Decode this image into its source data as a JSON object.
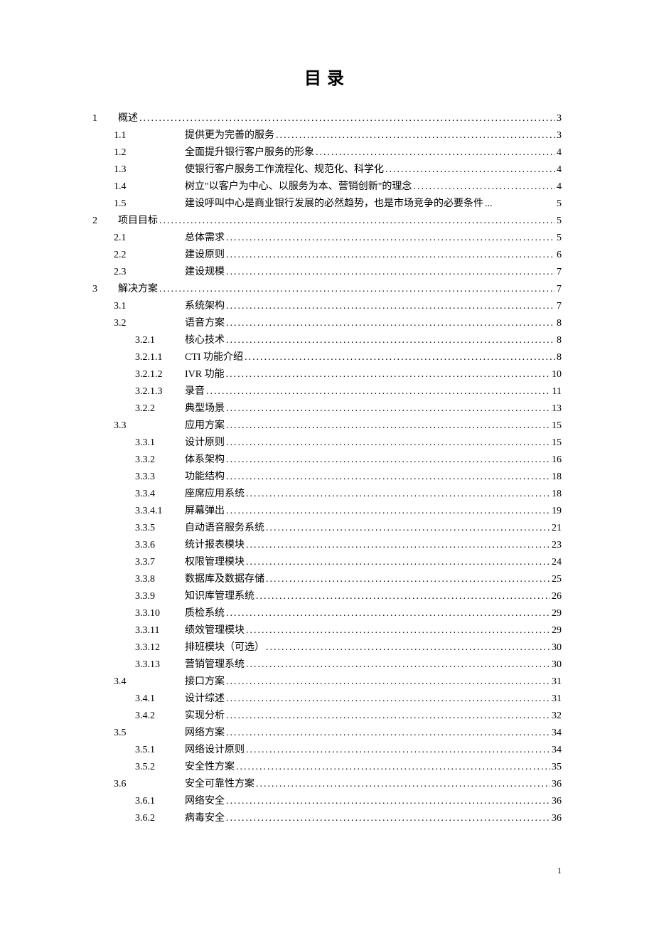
{
  "title": "目录",
  "page_number": "1",
  "toc": [
    {
      "level": 0,
      "num": "1",
      "text": "概述",
      "page": "3",
      "inlineSection": true
    },
    {
      "level": 1,
      "num": "1.1",
      "text": "提供更为完善的服务",
      "page": "3"
    },
    {
      "level": 1,
      "num": "1.2",
      "text": "全面提升银行客户服务的形象",
      "page": "4"
    },
    {
      "level": 1,
      "num": "1.3",
      "text": "使银行客户服务工作流程化、规范化、科学化",
      "page": "4"
    },
    {
      "level": 1,
      "num": "1.4",
      "text": "树立\"以客户为中心、以服务为本、营销创新\"的理念",
      "page": "4"
    },
    {
      "level": 1,
      "num": "1.5",
      "text": "建设呼叫中心是商业银行发展的必然趋势，也是市场竞争的必要条件",
      "page": "5",
      "tight": true
    },
    {
      "level": 0,
      "num": "2",
      "text": "项目目标",
      "page": "5",
      "inlineSection": true
    },
    {
      "level": 1,
      "num": "2.1",
      "text": "总体需求",
      "page": "5"
    },
    {
      "level": 1,
      "num": "2.2",
      "text": "建设原则",
      "page": "6"
    },
    {
      "level": 1,
      "num": "2.3",
      "text": "建设规模",
      "page": "7"
    },
    {
      "level": 0,
      "num": "3",
      "text": "解决方案",
      "page": "7",
      "inlineSection": true
    },
    {
      "level": 1,
      "num": "3.1",
      "text": "系统架构",
      "page": "7"
    },
    {
      "level": 1,
      "num": "3.2",
      "text": "语音方案",
      "page": "8"
    },
    {
      "level": 2,
      "num": "3.2.1",
      "text": "核心技术",
      "page": "8"
    },
    {
      "level": 3,
      "num": "3.2.1.1",
      "text": "CTI 功能介绍",
      "page": "8"
    },
    {
      "level": 3,
      "num": "3.2.1.2",
      "text": "IVR 功能",
      "page": "10"
    },
    {
      "level": 3,
      "num": "3.2.1.3",
      "text": "录音",
      "page": "11"
    },
    {
      "level": 2,
      "num": "3.2.2",
      "text": "典型场景",
      "page": "13"
    },
    {
      "level": 1,
      "num": "3.3",
      "text": "应用方案",
      "page": "15"
    },
    {
      "level": 2,
      "num": "3.3.1",
      "text": "设计原则",
      "page": "15"
    },
    {
      "level": 2,
      "num": "3.3.2",
      "text": "体系架构",
      "page": "16"
    },
    {
      "level": 2,
      "num": "3.3.3",
      "text": "功能结构",
      "page": "18"
    },
    {
      "level": 2,
      "num": "3.3.4",
      "text": "座席应用系统",
      "page": "18"
    },
    {
      "level": 3,
      "num": "3.3.4.1",
      "text": "屏幕弹出",
      "page": "19"
    },
    {
      "level": 2,
      "num": "3.3.5",
      "text": "自动语音服务系统",
      "page": "21"
    },
    {
      "level": 2,
      "num": "3.3.6",
      "text": "统计报表模块",
      "page": "23"
    },
    {
      "level": 2,
      "num": "3.3.7",
      "text": "权限管理模块",
      "page": "24"
    },
    {
      "level": 2,
      "num": "3.3.8",
      "text": "数据库及数据存储",
      "page": "25"
    },
    {
      "level": 2,
      "num": "3.3.9",
      "text": "知识库管理系统",
      "page": "26"
    },
    {
      "level": 2,
      "num": "3.3.10",
      "text": "质检系统",
      "page": "29"
    },
    {
      "level": 2,
      "num": "3.3.11",
      "text": "绩效管理模块",
      "page": "29"
    },
    {
      "level": 2,
      "num": "3.3.12",
      "text": "排班模块（可选）",
      "page": "30"
    },
    {
      "level": 2,
      "num": "3.3.13",
      "text": "营销管理系统",
      "page": "30"
    },
    {
      "level": 1,
      "num": "3.4",
      "text": "接口方案",
      "page": "31"
    },
    {
      "level": 2,
      "num": "3.4.1",
      "text": "设计综述",
      "page": "31"
    },
    {
      "level": 2,
      "num": "3.4.2",
      "text": "实现分析",
      "page": "32"
    },
    {
      "level": 1,
      "num": "3.5",
      "text": "网络方案",
      "page": "34"
    },
    {
      "level": 2,
      "num": "3.5.1",
      "text": "网络设计原则",
      "page": "34"
    },
    {
      "level": 2,
      "num": "3.5.2",
      "text": "安全性方案",
      "page": "35"
    },
    {
      "level": 1,
      "num": "3.6",
      "text": "安全可靠性方案",
      "page": "36"
    },
    {
      "level": 2,
      "num": "3.6.1",
      "text": "网络安全",
      "page": "36"
    },
    {
      "level": 2,
      "num": "3.6.2",
      "text": "病毒安全",
      "page": "36"
    }
  ]
}
